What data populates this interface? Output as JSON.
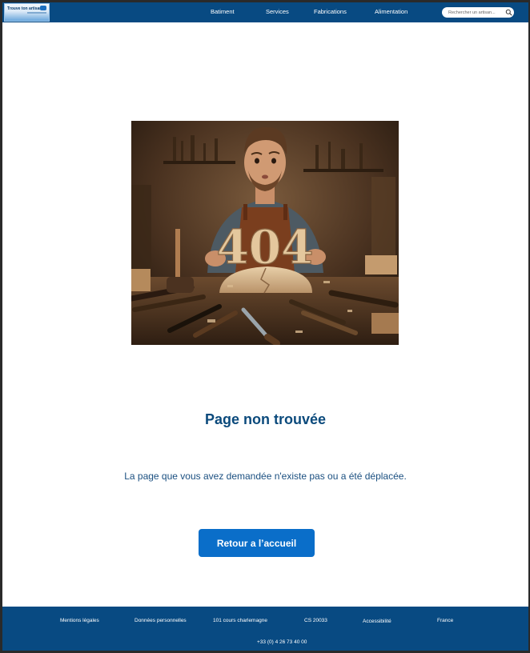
{
  "header": {
    "logo_text": "Trouve ton artisan !",
    "nav": [
      "Batiment",
      "Services",
      "Fabrications",
      "Alimentation"
    ],
    "search_placeholder": "Rechercher un artisan..."
  },
  "hero": {
    "image_text": "404"
  },
  "main": {
    "title": "Page non trouvée",
    "message": "La page que vous avez demandée n'existe pas ou a été déplacée.",
    "button_label": "Retour a l’accueil"
  },
  "footer": {
    "links": [
      "Mentions légales",
      "Données personnelles",
      "101 cours charlemagne",
      "CS 20033",
      "Accessibilité",
      "France"
    ],
    "phone": "+33 (0) 4 26 73 40 00"
  },
  "colors": {
    "header": "#084a82",
    "footer": "#084a82",
    "title": "#0b4a7c",
    "button": "#0a6ec9"
  }
}
